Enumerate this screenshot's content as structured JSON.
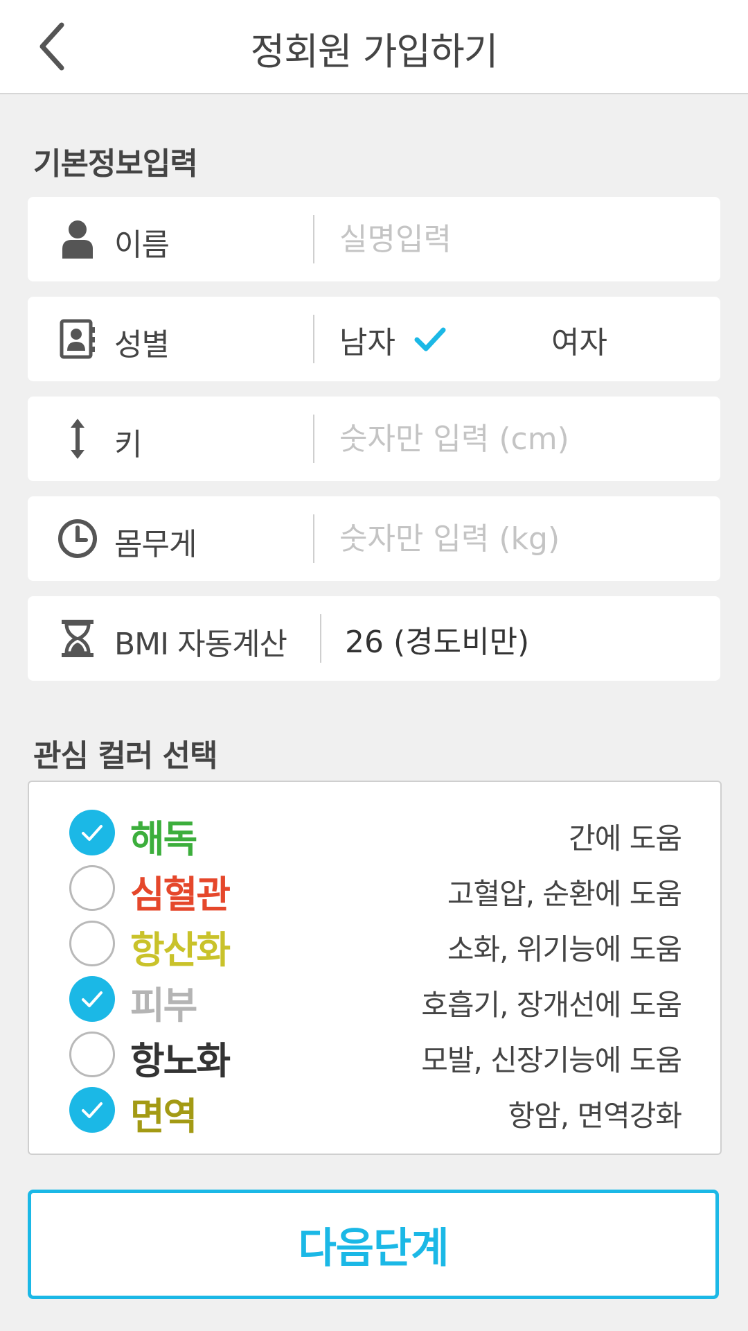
{
  "header": {
    "title": "정회원 가입하기",
    "back_icon": "chevron-left-icon"
  },
  "basic_info": {
    "section_title": "기본정보입력",
    "name": {
      "label": "이름",
      "placeholder": "실명입력"
    },
    "gender": {
      "label": "성별",
      "male": "남자",
      "female": "여자",
      "selected": "남자"
    },
    "height": {
      "label": "키",
      "placeholder": "숫자만 입력 (cm)"
    },
    "weight": {
      "label": "몸무게",
      "placeholder": "숫자만 입력 (kg)"
    },
    "bmi": {
      "label": "BMI 자동계산",
      "value": "26 (경도비만)"
    }
  },
  "colors": {
    "section_title": "관심 컬러 선택",
    "items": [
      {
        "name": "해독",
        "desc": "간에 도움",
        "checked": true,
        "color": "#3cae3c"
      },
      {
        "name": "심혈관",
        "desc": "고혈압, 순환에 도움",
        "checked": false,
        "color": "#e5472b"
      },
      {
        "name": "항산화",
        "desc": "소화, 위기능에 도움",
        "checked": false,
        "color": "#c9c22a"
      },
      {
        "name": "피부",
        "desc": "호흡기, 장개선에 도움",
        "checked": true,
        "color": "#b4b4b4"
      },
      {
        "name": "항노화",
        "desc": "모발, 신장기능에 도움",
        "checked": false,
        "color": "#333333"
      },
      {
        "name": "면역",
        "desc": "항암, 면역강화",
        "checked": true,
        "color": "#a39a14"
      }
    ]
  },
  "next_button": {
    "label": "다음단계"
  },
  "accent_color": "#1bb8e6"
}
